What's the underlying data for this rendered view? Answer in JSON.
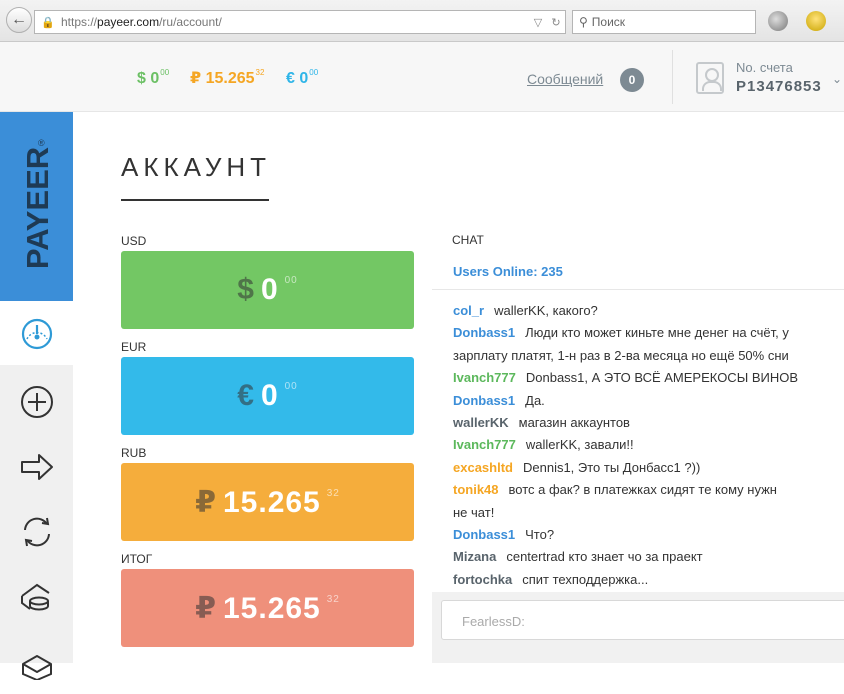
{
  "browser": {
    "url_prefix": "https://",
    "url_host": "payeer.com",
    "url_path": "/ru/account/",
    "search_placeholder": "Поиск"
  },
  "topbar": {
    "balances": [
      {
        "symbol": "$",
        "amount": "0",
        "cents": "00",
        "color": "#6cc065"
      },
      {
        "symbol": "₽",
        "amount": "15.265",
        "cents": "32",
        "color": "#f5a623"
      },
      {
        "symbol": "€",
        "amount": "0",
        "cents": "00",
        "color": "#2fb5e8"
      }
    ],
    "messages_label": "Сообщений",
    "messages_count": "0",
    "account_label": "No. счета",
    "account_number": "P13476853"
  },
  "sidebar": {
    "logo": "PAYEER",
    "logo_mark": "®",
    "items": [
      {
        "icon": "speedometer-icon",
        "active": true
      },
      {
        "icon": "plus-circle-icon",
        "active": false
      },
      {
        "icon": "arrow-right-icon",
        "active": false
      },
      {
        "icon": "exchange-icon",
        "active": false
      },
      {
        "icon": "wallet-coins-icon",
        "active": false
      },
      {
        "icon": "box-icon",
        "active": false
      }
    ]
  },
  "main": {
    "title": "АККАУНТ",
    "wallets": [
      {
        "label": "USD",
        "symbol": "$",
        "amount": "0",
        "cents": "00",
        "color": "#73c764"
      },
      {
        "label": "EUR",
        "symbol": "€",
        "amount": "0",
        "cents": "00",
        "color": "#33baea"
      },
      {
        "label": "RUB",
        "symbol": "₽",
        "amount": "15.265",
        "cents": "32",
        "color": "#f5ad3c"
      },
      {
        "label": "ИТОГ",
        "symbol": "₽",
        "amount": "15.265",
        "cents": "32",
        "color": "#ef907b"
      }
    ]
  },
  "chat": {
    "label": "CHAT",
    "online": "Users Online: 235",
    "input_placeholder": "FearlessD:",
    "messages": [
      {
        "nick": "col_r",
        "text": "wallerKK, какого?",
        "color": "#3b8ed8"
      },
      {
        "nick": "Donbass1",
        "text": "Люди кто может киньте мне денег на счёт, у",
        "color": "#3b8ed8"
      },
      {
        "nick": "",
        "text": "зарплату платят, 1-н раз в 2-ва месяца но ещё 50% сни",
        "color": "#333"
      },
      {
        "nick": "Ivanch777",
        "text": "Donbass1, А ЭТО ВСЁ АМЕРЕКОСЫ ВИНОВ",
        "color": "#5cb85c"
      },
      {
        "nick": "Donbass1",
        "text": "Да.",
        "color": "#3b8ed8"
      },
      {
        "nick": "wallerKK",
        "text": "магазин аккаунтов",
        "color": "#59646c"
      },
      {
        "nick": "Ivanch777",
        "text": "wallerKK, завали!!",
        "color": "#5cb85c"
      },
      {
        "nick": "excashltd",
        "text": "Dennis1, Это ты Донбасс1 ?))",
        "color": "#f5a623"
      },
      {
        "nick": "tonik48",
        "text": "вотс а фак? в платежках сидят те кому нужн",
        "color": "#f5a623"
      },
      {
        "nick": "",
        "text": "не чат!",
        "color": "#333"
      },
      {
        "nick": "Donbass1",
        "text": "Что?",
        "color": "#3b8ed8"
      },
      {
        "nick": "Mizana",
        "text": "centertrad кто знает чо за праект",
        "color": "#59646c"
      },
      {
        "nick": "fortochka",
        "text": "спит техподдержка...",
        "color": "#59646c"
      }
    ]
  }
}
